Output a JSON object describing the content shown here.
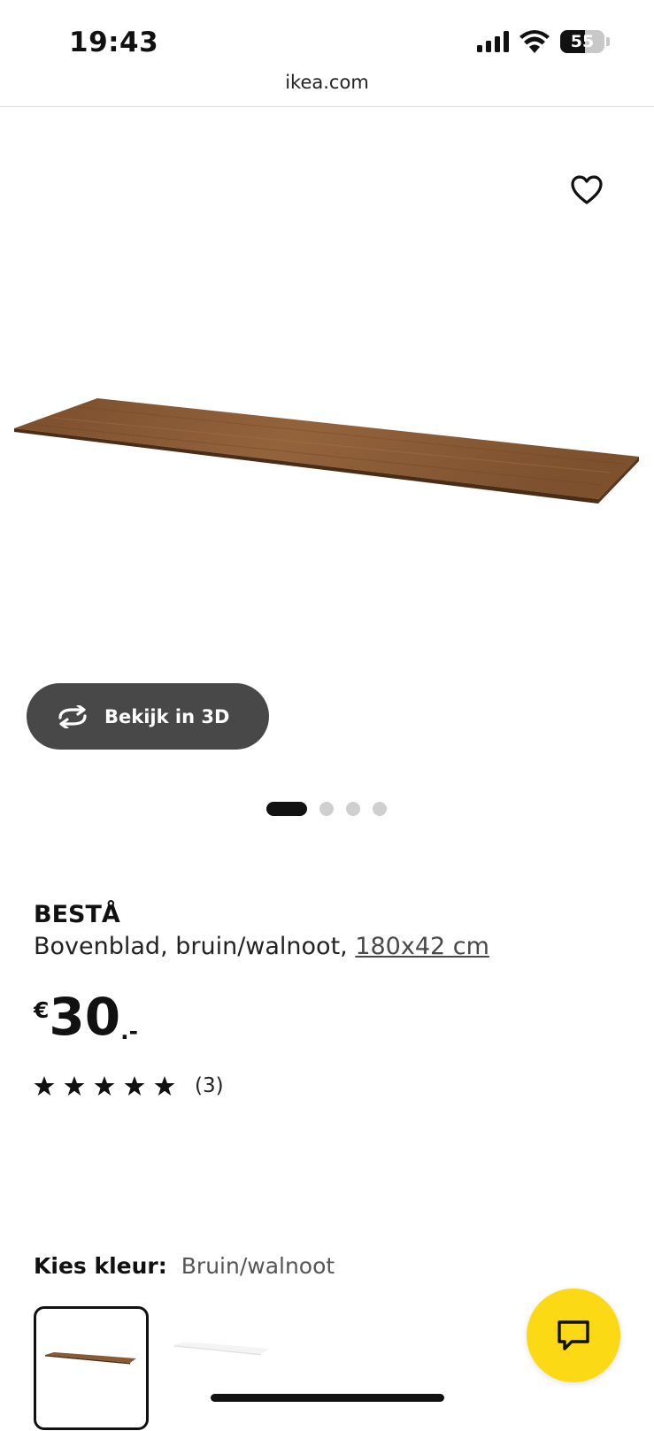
{
  "status_bar": {
    "time": "19:43",
    "battery_level": "55",
    "icons": [
      "cellular-signal-icon",
      "wifi-icon",
      "battery-icon"
    ]
  },
  "browser": {
    "url": "ikea.com"
  },
  "gallery": {
    "favorite_icon": "heart-outline-icon",
    "view_3d_label": "Bekijk in 3D",
    "view_3d_icon": "rotate-3d-icon",
    "slide_count": 4,
    "active_slide": 1
  },
  "product": {
    "name": "BESTÅ",
    "description": "Bovenblad, bruin/walnoot, ",
    "size": "180x42 cm",
    "price": {
      "currency": "€",
      "amount": "30",
      "suffix": ".-"
    },
    "rating": {
      "stars": 5,
      "count": "(3)"
    }
  },
  "color_picker": {
    "label": "Kies kleur:",
    "selected": "Bruin/walnoot",
    "options": [
      "bruin/walnoot",
      "wit"
    ]
  },
  "chat": {
    "icon": "chat-bubble-icon"
  },
  "colors": {
    "brand_yellow": "#fbd914",
    "wood": "#8a5a34",
    "button_dark": "#484848"
  }
}
